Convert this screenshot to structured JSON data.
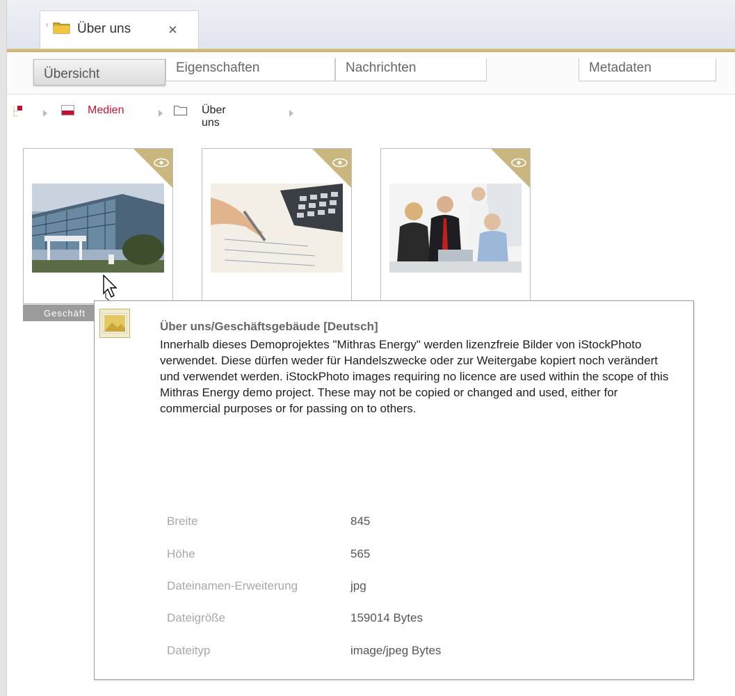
{
  "tab": {
    "label": "Über uns",
    "close": "×"
  },
  "subtabs": [
    {
      "label": "Übersicht"
    },
    {
      "label": "Eigenschaften"
    },
    {
      "label": "Nachrichten"
    },
    {
      "label": "Metadaten"
    }
  ],
  "breadcrumb": {
    "root": "Medien",
    "folder": "Über uns"
  },
  "thumbnails": [
    {
      "caption": "Geschäft"
    },
    {
      "caption": ""
    },
    {
      "caption": ""
    }
  ],
  "tooltip": {
    "title": "Über uns/Geschäftsgebäude [Deutsch]",
    "description": "Innerhalb dieses Demoprojektes \"Mithras Energy\" werden lizenzfreie Bilder von iStockPhoto verwendet. Diese dürfen weder für Handelszwecke oder zur Weitergabe kopiert noch verändert und verwendet werden. iStockPhoto images requiring no licence are used within the scope of this Mithras Energy demo project. These may not be copied or changed and used, either for commercial purposes or for passing on to others.",
    "meta": [
      {
        "label": "Breite",
        "value": "845"
      },
      {
        "label": "Höhe",
        "value": "565"
      },
      {
        "label": "Dateinamen-Erweiterung",
        "value": "jpg"
      },
      {
        "label": "Dateigröße",
        "value": "159014 Bytes"
      },
      {
        "label": "Dateityp",
        "value": "image/jpeg Bytes"
      }
    ]
  },
  "colors": {
    "accent_gold": "#c9b06b",
    "crumb_red": "#c8102e"
  },
  "icons": {
    "tab": "folder-icon",
    "eye": "eye-icon",
    "image": "image-icon"
  }
}
